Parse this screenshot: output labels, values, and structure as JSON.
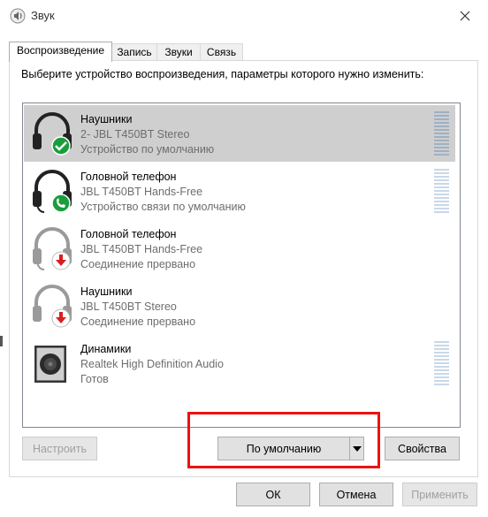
{
  "window": {
    "title": "Звук"
  },
  "tabs": [
    {
      "label": "Воспроизведение",
      "active": true
    },
    {
      "label": "Запись",
      "active": false
    },
    {
      "label": "Звуки",
      "active": false
    },
    {
      "label": "Связь",
      "active": false
    }
  ],
  "instruction": "Выберите устройство воспроизведения, параметры которого нужно изменить:",
  "devices": [
    {
      "name": "Наушники",
      "description": "2- JBL T450BT Stereo",
      "status": "Устройство по умолчанию",
      "icon": "headphones-icon",
      "badge": "default-check-badge",
      "selected": true
    },
    {
      "name": "Головной телефон",
      "description": "JBL T450BT Hands-Free",
      "status": "Устройство связи по умолчанию",
      "icon": "headset-icon",
      "badge": "phone-badge",
      "selected": false
    },
    {
      "name": "Головной телефон",
      "description": "JBL T450BT Hands-Free",
      "status": "Соединение прервано",
      "icon": "headset-icon",
      "badge": "disconnected-arrow-badge",
      "selected": false
    },
    {
      "name": "Наушники",
      "description": "JBL T450BT Stereo",
      "status": "Соединение прервано",
      "icon": "headphones-icon",
      "badge": "disconnected-arrow-badge",
      "selected": false
    },
    {
      "name": "Динамики",
      "description": "Realtek High Definition Audio",
      "status": "Готов",
      "icon": "speaker-icon",
      "badge": "",
      "selected": false
    }
  ],
  "buttons": {
    "configure": "Настроить",
    "set_default": "По умолчанию",
    "properties": "Свойства",
    "ok": "ОК",
    "cancel": "Отмена",
    "apply": "Применить"
  },
  "colors": {
    "selected_row": "#cfcfcf",
    "highlight_box": "#ee1111",
    "check_badge": "#1a9e3c",
    "disconnect_badge": "#d81e1e"
  }
}
